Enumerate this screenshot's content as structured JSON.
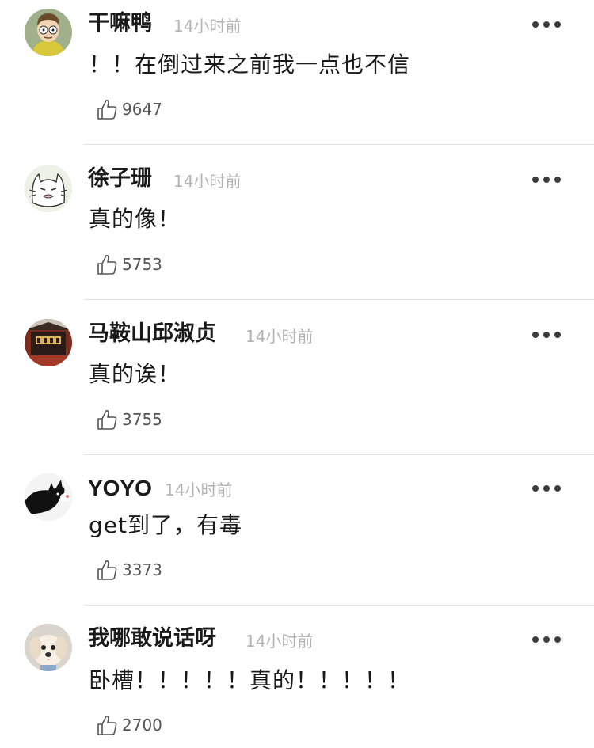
{
  "comments": [
    {
      "username": "干嘛鸭",
      "time": "14小时前",
      "content": "！！在倒过来之前我一点也不信",
      "likes": "9647",
      "avatar_icon": "rick-morty-avatar-icon"
    },
    {
      "username": "徐子珊",
      "time": "14小时前",
      "content": "真的像！",
      "likes": "5753",
      "avatar_icon": "cartoon-cat-avatar-icon"
    },
    {
      "username": "马鞍山邱淑贞",
      "time": "14小时前",
      "content": "真的诶！",
      "likes": "3755",
      "avatar_icon": "gate-building-avatar-icon"
    },
    {
      "username": "YOYO",
      "time": "14小时前",
      "content": "get到了，有毒",
      "likes": "3373",
      "avatar_icon": "black-cat-avatar-icon"
    },
    {
      "username": "我哪敢说话呀",
      "time": "14小时前",
      "content": "卧槽！！！！！真的！！！！！",
      "likes": "2700",
      "avatar_icon": "puppy-avatar-icon"
    }
  ],
  "colors": {
    "username": "#1a1a1a",
    "time": "#b3b3b3",
    "content": "#1a1a1a",
    "like_count": "#555555",
    "divider": "#e0e0e0"
  }
}
